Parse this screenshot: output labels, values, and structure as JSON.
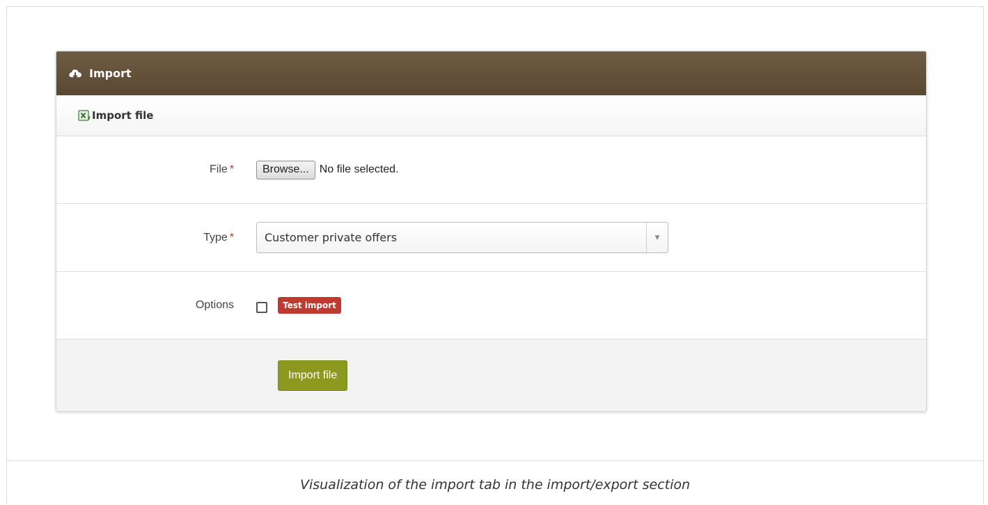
{
  "panel": {
    "title": "Import",
    "header_icon": "cloud-download-icon",
    "section_title": "Import file",
    "section_icon": "excel-file-icon"
  },
  "form": {
    "file": {
      "label": "File",
      "required_mark": "*",
      "browse_label": "Browse...",
      "status": "No file selected."
    },
    "type": {
      "label": "Type",
      "required_mark": "*",
      "selected": "Customer private offers"
    },
    "options": {
      "label": "Options",
      "checkbox_checked": false,
      "badge": "Test import"
    },
    "submit_label": "Import file"
  },
  "caption": "Visualization of the import tab in the import/export section",
  "colors": {
    "header": "#5f4d37",
    "submit": "#8b9a1e",
    "badge": "#c0392f",
    "required": "#d9302c"
  }
}
